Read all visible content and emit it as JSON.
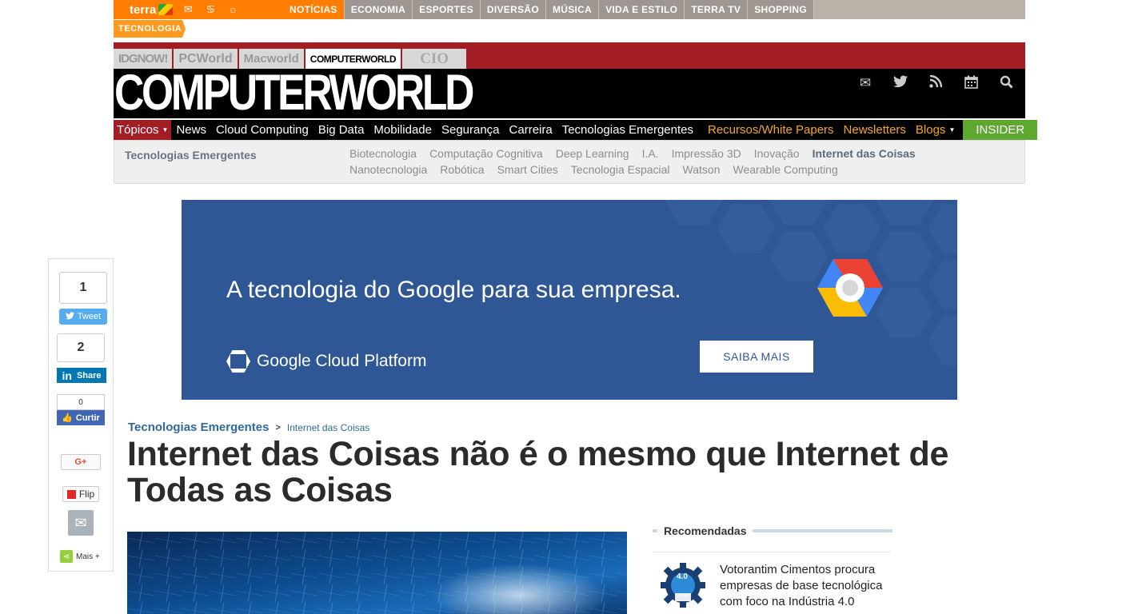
{
  "terra": {
    "logo": "terra",
    "nav": [
      "NOTÍCIAS",
      "ECONOMIA",
      "ESPORTES",
      "DIVERSÃO",
      "MÚSICA",
      "VIDA E ESTILO",
      "TERRA TV",
      "SHOPPING"
    ],
    "section_tab": "TECNOLOGIA"
  },
  "brands": [
    "IDGNOW!",
    "PCWorld",
    "Macworld",
    "COMPUTERWORLD",
    "CIO"
  ],
  "header": {
    "logo": "COMPUTERWORLD",
    "icons": [
      "mail-icon",
      "twitter-icon",
      "rss-icon",
      "calendar-icon",
      "search-icon"
    ]
  },
  "nav": {
    "topicos": "Tópicos",
    "items": [
      "News",
      "Cloud Computing",
      "Big Data",
      "Mobilidade",
      "Segurança",
      "Carreira",
      "Tecnologias Emergentes"
    ],
    "gold_items": [
      "Recursos/White Papers",
      "Newsletters",
      "Blogs"
    ],
    "insider": "INSIDER"
  },
  "subnav": {
    "title": "Tecnologias Emergentes",
    "links": [
      "Biotecnologia",
      "Computação Cognitiva",
      "Deep Learning",
      "I.A.",
      "Impressão 3D",
      "Inovação",
      "Internet das Coisas",
      "Nanotecnologia",
      "Robótica",
      "Smart Cities",
      "Tecnologia Espacial",
      "Watson",
      "Wearable Computing"
    ],
    "current": "Internet das Coisas"
  },
  "ad": {
    "headline": "A tecnologia do Google para sua empresa.",
    "brand": "Google Cloud Platform",
    "cta": "SAIBA MAIS",
    "colors": {
      "background": "#2f5796",
      "red": "#ea4335",
      "yellow": "#fbbc05",
      "blue": "#4285f4"
    }
  },
  "share": {
    "tweet_count": "1",
    "tweet_label": "Tweet",
    "linkedin_count": "2",
    "linkedin_label": "Share",
    "facebook_count": "0",
    "facebook_label": "Curtir",
    "gplus_label": "G+",
    "flip_label": "Flip",
    "more_label": "Mais +"
  },
  "article": {
    "breadcrumb": [
      "Tecnologias Emergentes",
      ">",
      "Internet das Coisas"
    ],
    "title": "Internet das Coisas não é o mesmo que Internet de Todas as Coisas"
  },
  "recommended": {
    "heading": "Recomendadas",
    "items": [
      {
        "badge": "4.0",
        "text": "Votorantim Cimentos procura empresas de base tecnológica com foco na Indústria 4.0"
      }
    ]
  }
}
